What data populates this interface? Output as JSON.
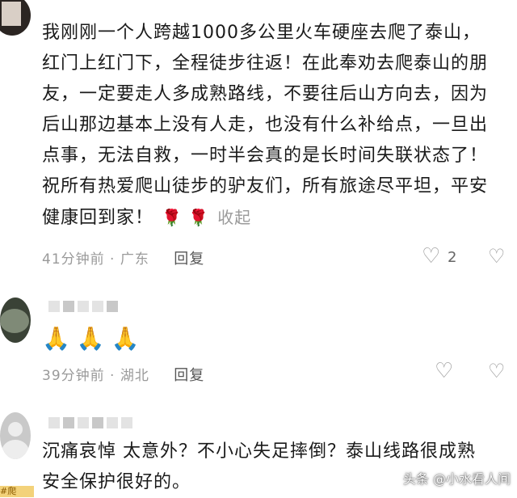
{
  "comments": [
    {
      "lines": [
        "我刚刚一个人跨越1000多公里火车硬座去爬了泰山，",
        "红门上红门下，全程徒步往返！在此奉劝去爬泰山的朋",
        "友，一定要走人多成熟路线，不要往后山方向去，因为",
        "后山那边基本上没有人走，也没有什么补给点，一旦出",
        "点事，无法自救，一时半会真的是长时间失联状态了！",
        "祝所有热爱爬山徒步的驴友们，所有旅途尽平坦，平安",
        "健康回到家！"
      ],
      "roses": "🌹 🌹",
      "collapse_label": "收起",
      "time": "41分钟前",
      "location": "广东",
      "reply_label": "回复",
      "like_count": "2"
    },
    {
      "emoji_text": "🙏🙏🙏",
      "time": "39分钟前",
      "location": "湖北",
      "reply_label": "回复"
    },
    {
      "lines": [
        "沉痛哀悼  太意外？不小心失足摔倒？泰山线路很成熟",
        "安全保护很好的。"
      ]
    }
  ],
  "separator": " · ",
  "watermark": "头条 @小水看人间",
  "edge_tag": "#爬",
  "icons": {
    "like": "heart-outline-icon",
    "dislike": "broken-heart-icon"
  }
}
